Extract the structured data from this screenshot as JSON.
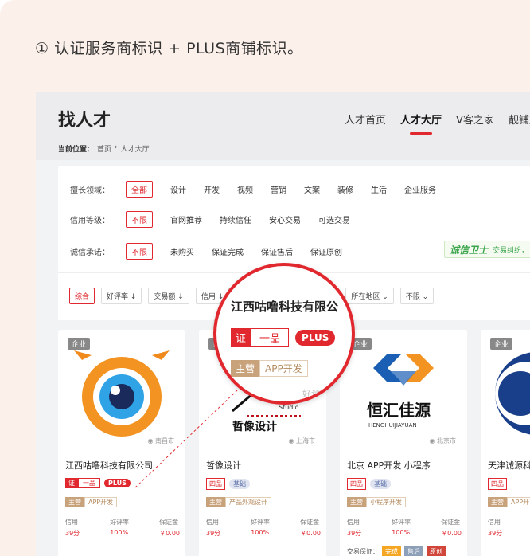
{
  "caption": "① 认证服务商标识 + PLUS商铺标识。",
  "header": {
    "title": "找人才",
    "nav": [
      "人才首页",
      "人才大厅",
      "V客之家",
      "靓铺服"
    ],
    "breadcrumb_label": "当前位置：",
    "breadcrumb": [
      "首页",
      "人才大厅"
    ]
  },
  "filters": {
    "rows": [
      {
        "label": "擅长领域：",
        "items": [
          "全部",
          "设计",
          "开发",
          "视频",
          "营销",
          "文案",
          "装修",
          "生活",
          "企业服务"
        ]
      },
      {
        "label": "信用等级：",
        "items": [
          "不限",
          "官网推荐",
          "持续信任",
          "安心交易",
          "可选交易"
        ]
      },
      {
        "label": "诚信承诺：",
        "items": [
          "不限",
          "未购买",
          "保证完成",
          "保证售后",
          "保证原创"
        ]
      }
    ],
    "guard": {
      "brand": "诚信卫士",
      "text": "交易纠纷，"
    }
  },
  "sort": {
    "left": [
      "综合",
      "好评率 ↓",
      "交易额 ↓",
      "信用 ↓"
    ],
    "right": [
      "率 ↓",
      "所在地区 ⌄",
      "不限 ⌄"
    ]
  },
  "cards": [
    {
      "badge": "企业",
      "location": "南昌市",
      "name": "江西咕噜科技有限公司",
      "cert": [
        "证",
        "一品"
      ],
      "plus": "PLUS",
      "main_key": "主营",
      "main_val": "APP开发",
      "stats": [
        {
          "k": "信用",
          "v": "39分"
        },
        {
          "k": "好评率",
          "v": "100%"
        },
        {
          "k": "保证金",
          "v": "￥0.00"
        }
      ]
    },
    {
      "badge": "企业",
      "location": "上海市",
      "name": "哲像设计",
      "tag1": "四品",
      "tag2": "基础",
      "main_key": "主营",
      "main_val": "产品外观设计",
      "stats": [
        {
          "k": "信用",
          "v": "39分"
        },
        {
          "k": "好评率",
          "v": "100%"
        },
        {
          "k": "保证金",
          "v": "￥0.00"
        }
      ],
      "logo_text": "哲像设计",
      "studio": "Studio"
    },
    {
      "badge": "企业",
      "location": "北京市",
      "name": "北京 APP开发 小程序",
      "tag1": "四品",
      "tag2": "基础",
      "main_key": "主营",
      "main_val": "小程序开发",
      "stats": [
        {
          "k": "信用",
          "v": "39分"
        },
        {
          "k": "好评率",
          "v": "100%"
        },
        {
          "k": "保证金",
          "v": "￥0.00"
        }
      ],
      "logo_cn": "恒汇佳源",
      "logo_en": "HENGHUIJIAYUAN",
      "trade_label": "交易保证：",
      "trade": [
        "完成",
        "售后",
        "原创"
      ]
    },
    {
      "badge": "企业",
      "name": "天津诚源科",
      "tag1": "四品",
      "main_key": "主营",
      "main_val": "APP开",
      "stats": [
        {
          "k": "信用",
          "v": "39分"
        }
      ]
    }
  ],
  "magnifier": {
    "title": "江西咕噜科技有限公",
    "cert": [
      "证",
      "一品"
    ],
    "plus": "PLUS",
    "main_key": "主营",
    "main_val": "APP开发",
    "ghost": "好评"
  },
  "colors": {
    "accent": "#e0282e",
    "bg": "#fcf1ea",
    "main_tag": "#c8a27a"
  }
}
